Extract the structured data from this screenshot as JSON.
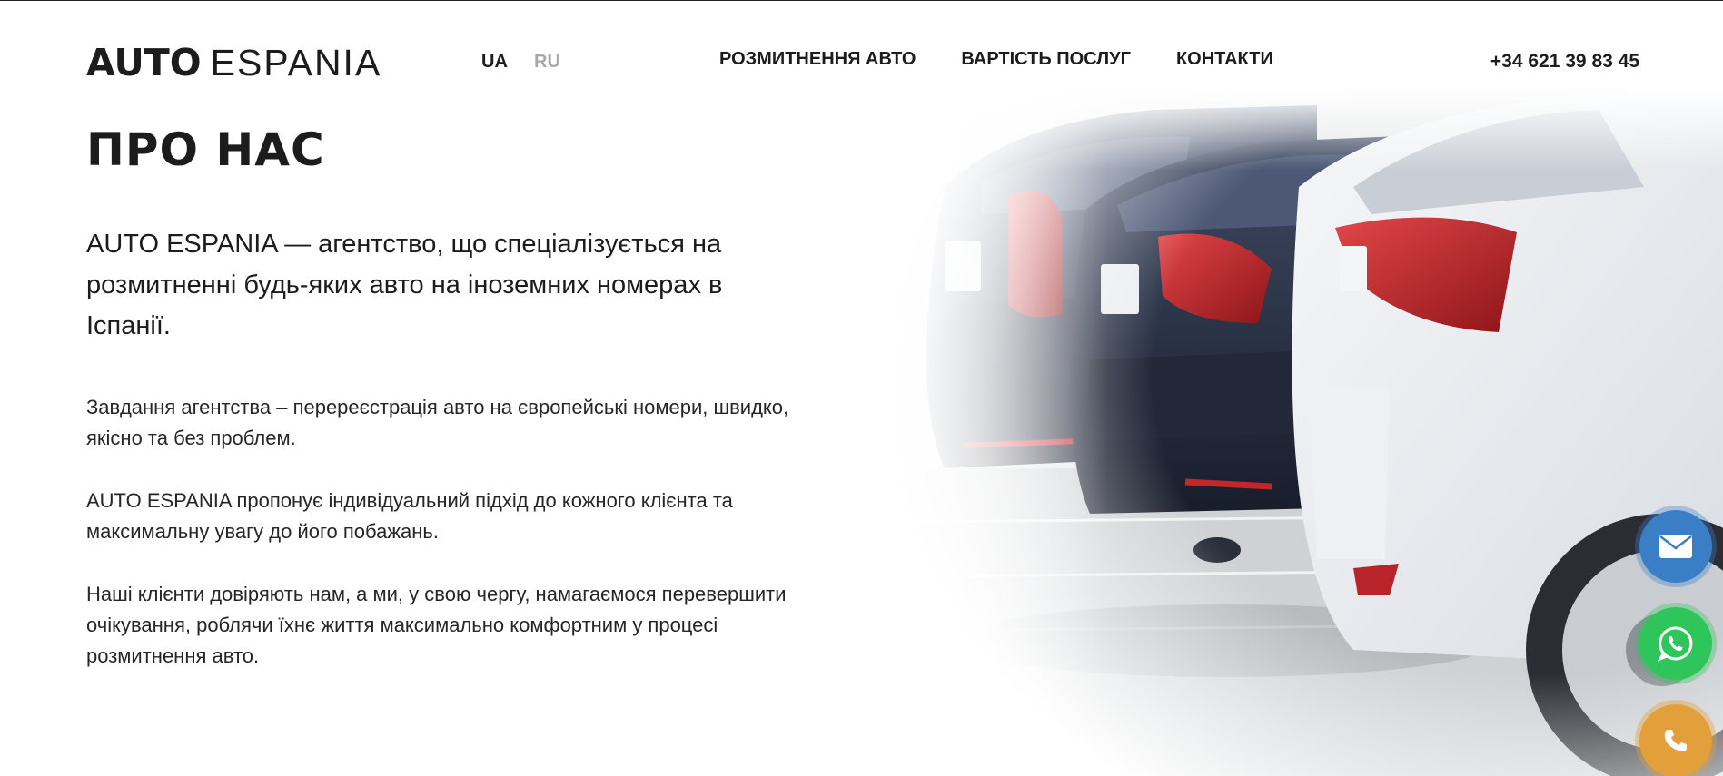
{
  "header": {
    "logo": {
      "bold": "AUTO",
      "light": "ESPANIA"
    },
    "languages": [
      {
        "label": "UA",
        "active": true
      },
      {
        "label": "RU",
        "active": false
      }
    ],
    "nav": [
      {
        "label": "РОЗМИТНЕННЯ АВТО"
      },
      {
        "label": "ВАРТІСТЬ ПОСЛУГ"
      },
      {
        "label": "КОНТАКТИ"
      }
    ],
    "phone": "+34 621 39 83 45"
  },
  "main": {
    "title": "ПРО НАС",
    "lead": "AUTO ESPANIA — агентство, що спеціалізується на розмитненні будь-яких авто на іноземних номерах в Іспанії.",
    "paragraphs": [
      "Завдання агентства – перереєстрація авто на європейські номери, швидко, якісно та без проблем.",
      "AUTO ESPANIA пропонує індивідуальний підхід до кожного клієнта та максимальну увагу до його побажань.",
      "Наші клієнти довіряють нам, а ми, у свою чергу, намагаємося перевершити очікування, роблячи їхнє життя максимально комфортним у процесі розмитнення авто."
    ]
  },
  "floating_buttons": [
    {
      "icon": "mail-icon",
      "color": "#3a7fc6"
    },
    {
      "icon": "whatsapp-icon",
      "color": "#2ec55a"
    },
    {
      "icon": "phone-icon",
      "color": "#e3a03a"
    }
  ],
  "colors": {
    "text": "#1c1c1c",
    "inactive_lang": "#a8a8a8"
  }
}
